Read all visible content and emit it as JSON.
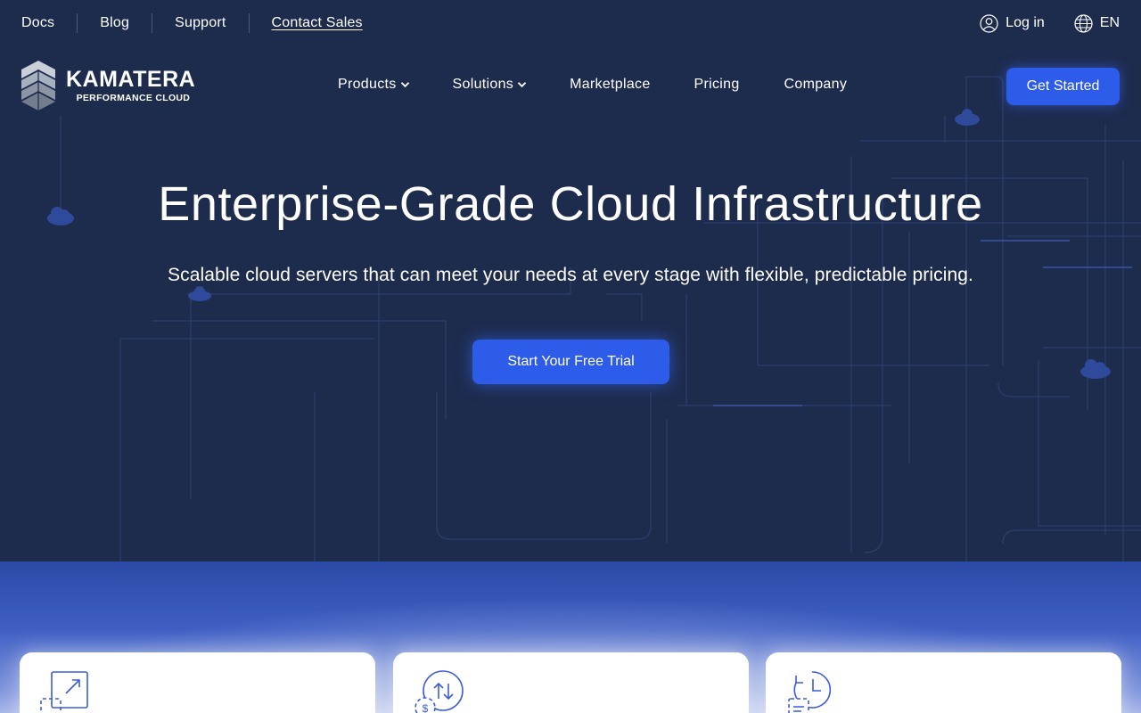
{
  "topbar": {
    "links": [
      "Docs",
      "Blog",
      "Support",
      "Contact Sales"
    ],
    "login_label": "Log in",
    "language_label": "EN"
  },
  "brand": {
    "name": "KAMATERA",
    "tagline": "PERFORMANCE CLOUD"
  },
  "nav": {
    "items": [
      "Products",
      "Solutions",
      "Marketplace",
      "Pricing",
      "Company"
    ],
    "cta_label": "Get Started"
  },
  "hero": {
    "title": "Enterprise-Grade Cloud Infrastructure",
    "subtitle": "Scalable cloud servers that can meet your needs at every stage with flexible, predictable pricing.",
    "cta_label": "Start Your Free Trial"
  },
  "features": {
    "cards": [
      {
        "icon": "scale-resize-icon"
      },
      {
        "icon": "billing-transfer-icon"
      },
      {
        "icon": "scheduled-document-icon"
      }
    ]
  },
  "colors": {
    "background": "#1d2b4d",
    "accent": "#2d5bea",
    "feature_band": "#3f5fc4"
  }
}
